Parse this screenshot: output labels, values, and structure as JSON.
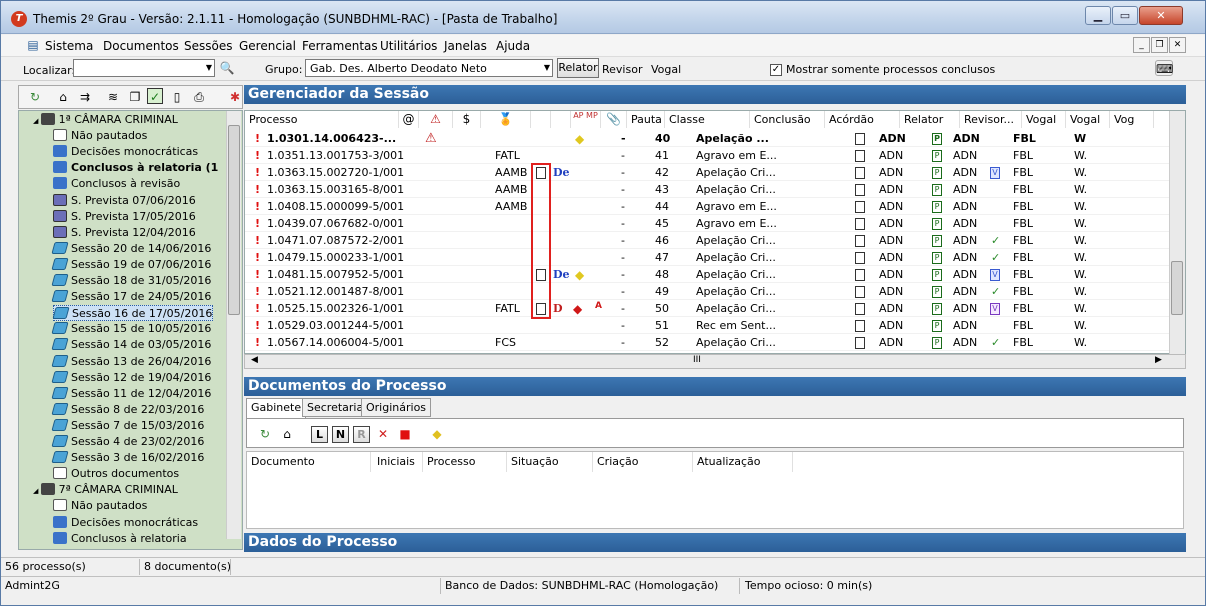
{
  "window": {
    "title": "Themis 2º Grau - Versão: 2.1.11 - Homologação (SUNBDHML-RAC) - [Pasta de Trabalho]"
  },
  "menu": [
    "Sistema",
    "Documentos",
    "Sessões",
    "Gerencial",
    "Ferramentas",
    "Utilitários",
    "Janelas",
    "Ajuda"
  ],
  "toolbar": {
    "localizar_label": "Localizar:",
    "localizar_value": "",
    "grupo_label": "Grupo:",
    "grupo_value": "Gab. Des. Alberto Deodato Neto",
    "relator_btn": "Relator",
    "revisor_label": "Revisor",
    "vogal_label": "Vogal",
    "mostrar_label": "Mostrar somente processos conclusos",
    "mostrar_checked": true
  },
  "tree": [
    {
      "label": "1ª CÂMARA CRIMINAL",
      "level": 0,
      "icon": "bk",
      "bold": false
    },
    {
      "label": "Não pautados",
      "level": 1,
      "icon": "doc"
    },
    {
      "label": "Decisões monocráticas",
      "level": 1,
      "icon": "usr"
    },
    {
      "label": "Conclusos à relatoria (1",
      "level": 1,
      "icon": "usr",
      "bold": true
    },
    {
      "label": "Conclusos à revisão",
      "level": 1,
      "icon": "usr"
    },
    {
      "label": "S. Prevista 07/06/2016",
      "level": 1,
      "icon": "hw"
    },
    {
      "label": "S. Prevista 17/05/2016",
      "level": 1,
      "icon": "hw"
    },
    {
      "label": "S. Prevista 12/04/2016",
      "level": 1,
      "icon": "hw"
    },
    {
      "label": "Sessão 20 de 14/06/2016",
      "level": 1,
      "icon": "sess"
    },
    {
      "label": "Sessão 19 de 07/06/2016",
      "level": 1,
      "icon": "sess"
    },
    {
      "label": "Sessão 18 de 31/05/2016",
      "level": 1,
      "icon": "sess"
    },
    {
      "label": "Sessão 17 de 24/05/2016",
      "level": 1,
      "icon": "sess"
    },
    {
      "label": "Sessão 16 de 17/05/2016",
      "level": 1,
      "icon": "sess",
      "selected": true
    },
    {
      "label": "Sessão 15 de 10/05/2016",
      "level": 1,
      "icon": "sess"
    },
    {
      "label": "Sessão 14 de 03/05/2016",
      "level": 1,
      "icon": "sess"
    },
    {
      "label": "Sessão 13 de 26/04/2016",
      "level": 1,
      "icon": "sess"
    },
    {
      "label": "Sessão 12 de 19/04/2016",
      "level": 1,
      "icon": "sess"
    },
    {
      "label": "Sessão 11 de 12/04/2016",
      "level": 1,
      "icon": "sess"
    },
    {
      "label": "Sessão 8 de 22/03/2016",
      "level": 1,
      "icon": "sess"
    },
    {
      "label": "Sessão 7 de 15/03/2016",
      "level": 1,
      "icon": "sess"
    },
    {
      "label": "Sessão 4 de 23/02/2016",
      "level": 1,
      "icon": "sess"
    },
    {
      "label": "Sessão 3 de 16/02/2016",
      "level": 1,
      "icon": "sess"
    },
    {
      "label": "Outros documentos",
      "level": 1,
      "icon": "doc"
    },
    {
      "label": "7ª CÂMARA CRIMINAL",
      "level": 0,
      "icon": "bk"
    },
    {
      "label": "Não pautados",
      "level": 1,
      "icon": "doc"
    },
    {
      "label": "Decisões monocráticas",
      "level": 1,
      "icon": "usr"
    },
    {
      "label": "Conclusos à relatoria",
      "level": 1,
      "icon": "usr"
    }
  ],
  "session_panel": {
    "title": "Gerenciador da Sessão"
  },
  "grid": {
    "headers": [
      "Processo",
      "@",
      "⚠",
      "$",
      "🏅",
      "",
      "",
      "AP MP",
      "📎",
      "Pauta",
      "Classe",
      "Conclusão",
      "Acórdão",
      "Relator",
      "Revisor...",
      "Vogal",
      "Vogal",
      "Vog"
    ],
    "rows": [
      {
        "processo": "1.0301.14.006423-...",
        "sigla": "",
        "doc": false,
        "tag": "",
        "yellow": true,
        "red": false,
        "aflag": "",
        "dash": "-",
        "pauta": "40",
        "classe": "Apelação ...",
        "acordao": "ADN",
        "relator": "ADN",
        "rev_icon": "",
        "revisor": "FBL",
        "vogal": "W",
        "bold": true,
        "warn": true
      },
      {
        "processo": "1.0351.13.001753-3/001",
        "sigla": "FATL",
        "doc": false,
        "tag": "",
        "yellow": false,
        "red": false,
        "aflag": "",
        "dash": "-",
        "pauta": "41",
        "classe": "Agravo em E...",
        "acordao": "ADN",
        "relator": "ADN",
        "rev_icon": "",
        "revisor": "FBL",
        "vogal": "W."
      },
      {
        "processo": "1.0363.15.002720-1/001",
        "sigla": "AAMB",
        "doc": true,
        "tag": "De",
        "yellow": false,
        "red": false,
        "aflag": "",
        "dash": "-",
        "pauta": "42",
        "classe": "Apelação Cri...",
        "acordao": "ADN",
        "relator": "ADN",
        "rev_icon": "V",
        "revisor": "FBL",
        "vogal": "W."
      },
      {
        "processo": "1.0363.15.003165-8/001",
        "sigla": "AAMB",
        "doc": false,
        "tag": "",
        "yellow": false,
        "red": false,
        "aflag": "",
        "dash": "-",
        "pauta": "43",
        "classe": "Apelação Cri...",
        "acordao": "ADN",
        "relator": "ADN",
        "rev_icon": "",
        "revisor": "FBL",
        "vogal": "W."
      },
      {
        "processo": "1.0408.15.000099-5/001",
        "sigla": "AAMB",
        "doc": false,
        "tag": "",
        "yellow": false,
        "red": false,
        "aflag": "",
        "dash": "-",
        "pauta": "44",
        "classe": "Agravo em E...",
        "acordao": "ADN",
        "relator": "ADN",
        "rev_icon": "",
        "revisor": "FBL",
        "vogal": "W."
      },
      {
        "processo": "1.0439.07.067682-0/001",
        "sigla": "",
        "doc": false,
        "tag": "",
        "yellow": false,
        "red": false,
        "aflag": "",
        "dash": "-",
        "pauta": "45",
        "classe": "Agravo em E...",
        "acordao": "ADN",
        "relator": "ADN",
        "rev_icon": "",
        "revisor": "FBL",
        "vogal": "W."
      },
      {
        "processo": "1.0471.07.087572-2/001",
        "sigla": "",
        "doc": false,
        "tag": "",
        "yellow": false,
        "red": false,
        "aflag": "",
        "dash": "-",
        "pauta": "46",
        "classe": "Apelação Cri...",
        "acordao": "ADN",
        "relator": "ADN",
        "rev_icon": "check",
        "revisor": "FBL",
        "vogal": "W."
      },
      {
        "processo": "1.0479.15.000233-1/001",
        "sigla": "",
        "doc": false,
        "tag": "",
        "yellow": false,
        "red": false,
        "aflag": "",
        "dash": "-",
        "pauta": "47",
        "classe": "Apelação Cri...",
        "acordao": "ADN",
        "relator": "ADN",
        "rev_icon": "check",
        "revisor": "FBL",
        "vogal": "W."
      },
      {
        "processo": "1.0481.15.007952-5/001",
        "sigla": "",
        "doc": true,
        "tag": "De",
        "yellow": true,
        "red": false,
        "aflag": "",
        "dash": "-",
        "pauta": "48",
        "classe": "Apelação Cri...",
        "acordao": "ADN",
        "relator": "ADN",
        "rev_icon": "V",
        "revisor": "FBL",
        "vogal": "W."
      },
      {
        "processo": "1.0521.12.001487-8/001",
        "sigla": "",
        "doc": false,
        "tag": "",
        "yellow": false,
        "red": false,
        "aflag": "",
        "dash": "-",
        "pauta": "49",
        "classe": "Apelação Cri...",
        "acordao": "ADN",
        "relator": "ADN",
        "rev_icon": "check",
        "revisor": "FBL",
        "vogal": "W."
      },
      {
        "processo": "1.0525.15.002326-1/001",
        "sigla": "FATL",
        "doc": true,
        "tag": "D",
        "yellow": false,
        "red": true,
        "aflag": "A",
        "dash": "-",
        "pauta": "50",
        "classe": "Apelação Cri...",
        "acordao": "ADN",
        "relator": "ADN",
        "rev_icon": "Vp",
        "revisor": "FBL",
        "vogal": "W."
      },
      {
        "processo": "1.0529.03.001244-5/001",
        "sigla": "",
        "doc": false,
        "tag": "",
        "yellow": false,
        "red": false,
        "aflag": "",
        "dash": "-",
        "pauta": "51",
        "classe": "Rec em Sent...",
        "acordao": "ADN",
        "relator": "ADN",
        "rev_icon": "",
        "revisor": "FBL",
        "vogal": "W."
      },
      {
        "processo": "1.0567.14.006004-5/001",
        "sigla": "FCS",
        "doc": false,
        "tag": "",
        "yellow": false,
        "red": false,
        "aflag": "",
        "dash": "-",
        "pauta": "52",
        "classe": "Apelação Cri...",
        "acordao": "ADN",
        "relator": "ADN",
        "rev_icon": "check",
        "revisor": "FBL",
        "vogal": "W."
      }
    ],
    "hscroll_label": "III"
  },
  "docs_panel": {
    "title": "Documentos do Processo",
    "tabs": [
      "Gabinete",
      "Secretaria",
      "Originários"
    ],
    "active_tab": 0,
    "tool_letters": [
      "L",
      "N",
      "R"
    ],
    "headers": [
      "Documento",
      "Iniciais",
      "Processo",
      "Situação",
      "Criação",
      "Atualização"
    ]
  },
  "dados_panel": {
    "title": "Dados do Processo"
  },
  "status": {
    "processos": "56 processo(s)",
    "documentos": "8 documento(s)",
    "user": "Admint2G",
    "banco": "Banco de Dados: SUNBDHML-RAC (Homologação)",
    "tempo": "Tempo ocioso: 0 min(s)"
  },
  "colors": {
    "accent": "#2c5f98",
    "tree_bg": "#cfe0c6",
    "highlight": "#e0201e"
  }
}
